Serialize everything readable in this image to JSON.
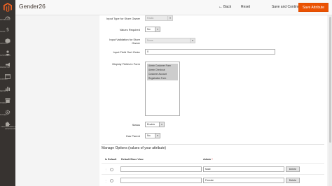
{
  "sidebar": {
    "items": [
      {
        "label": "DASHBOARD",
        "icon": "dashboard-icon"
      },
      {
        "label": "SALES",
        "icon": "dollar-icon"
      },
      {
        "label": "CATALOG",
        "icon": "cube-icon"
      },
      {
        "label": "CUSTOMERS",
        "icon": "person-icon"
      },
      {
        "label": "MARKETING",
        "icon": "megaphone-icon"
      },
      {
        "label": "CONTENT",
        "icon": "layout-icon"
      },
      {
        "label": "REPORTS",
        "icon": "bar-chart-icon"
      },
      {
        "label": "STORES",
        "icon": "store-icon"
      },
      {
        "label": "SYSTEM",
        "icon": "gear-icon"
      },
      {
        "label": "FIND PARTNERS & EXTENSIONS",
        "icon": "puzzle-icon"
      }
    ]
  },
  "header": {
    "title": "Gender26",
    "back_label": "Back",
    "reset_label": "Reset",
    "save_continue_label": "Save and Continue Edit",
    "save_label": "Save Attribute"
  },
  "form": {
    "input_type_label": "Input Type for Store Owner",
    "input_type_value": "Radio",
    "values_required_label": "Values Required",
    "values_required_value": "No",
    "input_validation_label": "Input Validation for Store Owner",
    "input_validation_value": "None",
    "sort_order_label": "Input Field Sort Order",
    "sort_order_value": "0",
    "display_fields_label": "Display Fields in Form",
    "display_fields_options": [
      "Admin Customer Form",
      "Admin Checkout",
      "Customer Account",
      "Registration Form"
    ],
    "status_label": "Status",
    "status_value": "Enable",
    "has_parent_label": "Has Parent",
    "has_parent_value": "No"
  },
  "options": {
    "section_title": "Manage Options (values of your attribute)",
    "col_is_default": "Is Default",
    "col_default_store_view": "Default Store View",
    "col_admin": "Admin",
    "rows": [
      {
        "default_store_view": "",
        "admin": "Male",
        "delete_label": "Delete"
      },
      {
        "default_store_view": "",
        "admin": "Female",
        "delete_label": "Delete"
      }
    ]
  },
  "colors": {
    "sidebar_bg": "#373330",
    "accent": "#eb5202",
    "logo": "#f26322"
  }
}
